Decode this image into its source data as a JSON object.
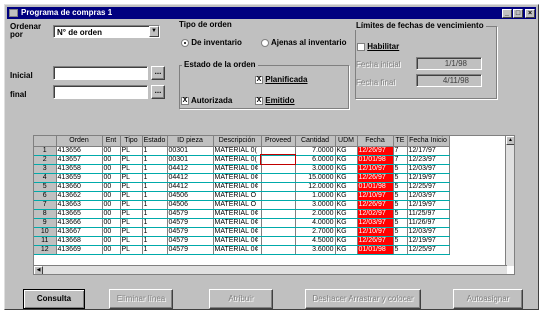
{
  "window": {
    "title": "Programa de compras 1"
  },
  "sort": {
    "label": "Ordenar por",
    "value": "N° de orden"
  },
  "range": {
    "initial_label": "Inicial",
    "final_label": "final",
    "initial_value": "",
    "final_value": "",
    "ellipsis": "..."
  },
  "order_type": {
    "title": "Tipo de orden",
    "options": [
      {
        "label": "De inventario",
        "selected": true
      },
      {
        "label": "Ajenas al inventario",
        "selected": false
      }
    ]
  },
  "order_state": {
    "title": "Estado de la orden",
    "planned": {
      "label": "Planificada",
      "checked": true
    },
    "authorized": {
      "label": "Autorizada",
      "checked": true
    },
    "issued": {
      "label": "Emitido",
      "checked": true
    },
    "check_mark": "X"
  },
  "due_limits": {
    "title": "Límites de fechas de vencimiento",
    "enable_label": "Habilitar",
    "start_label": "Fecha inicial",
    "start_value": "1/1/98",
    "end_label": "Fecha final",
    "end_value": "4/11/98"
  },
  "table": {
    "columns": [
      "",
      "Orden",
      "Ent",
      "Tipo",
      "Estado",
      "ID pieza",
      "Descripción",
      "Proveed",
      "Cantidad",
      "UDM",
      "Fecha",
      "TE",
      "Fecha Inicio"
    ],
    "rows": [
      [
        "1",
        "413656",
        "00",
        "PL",
        "1",
        "00301",
        "MATERIAL 0(",
        "",
        "7.0000",
        "KG",
        "12/26/97",
        "7",
        "12/17/97"
      ],
      [
        "2",
        "413657",
        "00",
        "PL",
        "1",
        "00301",
        "MATERIAL 0(",
        "",
        "6.0000",
        "KG",
        "01/01/98",
        "7",
        "12/23/97"
      ],
      [
        "3",
        "413658",
        "00",
        "PL",
        "1",
        "04412",
        "MATERIAL 0¢",
        "",
        "3.0000",
        "KG",
        "12/10/97",
        "5",
        "12/03/97"
      ],
      [
        "4",
        "413659",
        "00",
        "PL",
        "1",
        "04412",
        "MATERIAL 0¢",
        "",
        "15.0000",
        "KG",
        "12/26/97",
        "5",
        "12/19/97"
      ],
      [
        "5",
        "413660",
        "00",
        "PL",
        "1",
        "04412",
        "MATERIAL 0¢",
        "",
        "12.0000",
        "KG",
        "01/01/98",
        "5",
        "12/25/97"
      ],
      [
        "6",
        "413662",
        "00",
        "PL",
        "1",
        "04506",
        "MATERIAL O",
        "",
        "1.0000",
        "KG",
        "12/10/97",
        "5",
        "12/03/97"
      ],
      [
        "7",
        "413663",
        "00",
        "PL",
        "1",
        "04506",
        "MATERIAL O",
        "",
        "3.0000",
        "KG",
        "12/26/97",
        "5",
        "12/19/97"
      ],
      [
        "8",
        "413665",
        "00",
        "PL",
        "1",
        "04579",
        "MATERIAL 0¢",
        "",
        "2.0000",
        "KG",
        "12/02/97",
        "5",
        "11/25/97"
      ],
      [
        "9",
        "413666",
        "00",
        "PL",
        "1",
        "04579",
        "MATERIAL 0¢",
        "",
        "4.0000",
        "KG",
        "12/03/97",
        "5",
        "11/26/97"
      ],
      [
        "10",
        "413667",
        "00",
        "PL",
        "1",
        "04579",
        "MATERIAL 0¢",
        "",
        "2.7000",
        "KG",
        "12/10/97",
        "5",
        "12/03/97"
      ],
      [
        "11",
        "413668",
        "00",
        "PL",
        "1",
        "04579",
        "MATERIAL 0¢",
        "",
        "4.5000",
        "KG",
        "12/26/97",
        "5",
        "12/19/97"
      ],
      [
        "12",
        "413669",
        "00",
        "PL",
        "1",
        "04579",
        "MATERIAL 0¢",
        "",
        "3.6000",
        "KG",
        "01/01/98",
        "5",
        "12/25/97"
      ]
    ]
  },
  "buttons": {
    "query": "Consulta",
    "delete_line": "Eliminar línea",
    "assign": "Atribuir",
    "undo": "Deshacer Arrastrar y colocar",
    "auto_assign": "Autoasignar"
  },
  "colors": {
    "title_bar": "#000080",
    "late_date": "#ff0000",
    "face": "#c0c0c0"
  }
}
